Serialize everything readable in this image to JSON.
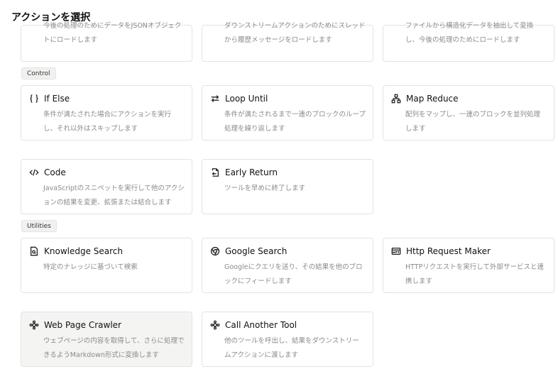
{
  "header": {
    "title": "アクションを選択"
  },
  "partial": [
    {
      "desc": "今後の処理のためにデータをJSONオブジェクトにロードします"
    },
    {
      "desc": "ダウンストリームアクションのためにスレッドから履歴メッセージをロードします"
    },
    {
      "desc": "ファイルから構造化データを抽出して変換し、今後の処理のためにロードします"
    }
  ],
  "sections": {
    "control": "Control",
    "utilities": "Utilities"
  },
  "control": [
    {
      "title": "If Else",
      "desc": "条件が満たされた場合にアクションを実行し、それ以外はスキップします",
      "icon": "braces-icon"
    },
    {
      "title": "Loop Until",
      "desc": "条件が満たされるまで一連のブロックのループ処理を繰り返します",
      "icon": "loop-arrows-icon"
    },
    {
      "title": "Map Reduce",
      "desc": "配列をマップし、一連のブロックを並列処理します",
      "icon": "hierarchy-icon"
    },
    {
      "title": "Code",
      "desc": "JavaScriptのスニペットを実行して他のアクションの結果を変更、拡張または結合します",
      "icon": "code-icon"
    },
    {
      "title": "Early Return",
      "desc": "ツールを早めに終了します",
      "icon": "return-doc-icon"
    }
  ],
  "utilities": [
    {
      "title": "Knowledge Search",
      "desc": "特定のナレッジに基づいて検索",
      "icon": "doc-search-icon"
    },
    {
      "title": "Google Search",
      "desc": "Googleにクエリを送り、その結果を他のブロックにフィードします",
      "icon": "google-icon"
    },
    {
      "title": "Http Request Maker",
      "desc": "HTTPリクエストを実行して外部サービスと連携します",
      "icon": "http-icon"
    },
    {
      "title": "Web Page Crawler",
      "desc": "ウェブページの内容を取得して、さらに処理できるようMarkdown形式に変換します",
      "icon": "crawler-icon"
    },
    {
      "title": "Call Another Tool",
      "desc": "他のツールを呼出し、結果をダウンストリームアクションに渡します",
      "icon": "tool-icon"
    }
  ]
}
